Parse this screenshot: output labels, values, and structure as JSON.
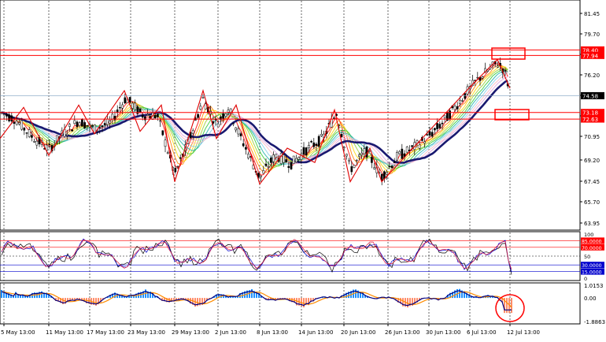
{
  "window": {
    "background": "#ffffff",
    "grid_color": "#000000",
    "axis_color": "#000000"
  },
  "main_panel": {
    "price_ticks": [
      "81.45",
      "79.70",
      "77.95",
      "76.20",
      "74.45",
      "72.70",
      "70.95",
      "69.20",
      "67.45",
      "65.70",
      "63.95"
    ],
    "price_range": [
      63.95,
      81.45
    ],
    "current_price": {
      "label": "74.58",
      "value": 74.58,
      "color": "#000000"
    },
    "resistance_zone": {
      "upper_label": "78.40",
      "lower_label": "77.94",
      "upper": 78.4,
      "lower": 77.94,
      "color": "#ff0000"
    },
    "support_zone": {
      "upper_label": "73.18",
      "lower_label": "72.63",
      "upper": 73.18,
      "lower": 72.63,
      "color": "#ff0000"
    },
    "colors": {
      "bull_candle": "#ffffff",
      "bear_candle": "#000000",
      "zigzag": "#e00000",
      "ma_main": "#191970",
      "rainbow": [
        "#ff0000",
        "#ff7f00",
        "#ffd700",
        "#9acd32",
        "#32cd32",
        "#20b2aa",
        "#87ceeb",
        "#ffb6c1",
        "#dda0dd"
      ]
    }
  },
  "oscillator_panel": {
    "ticks": [
      "100",
      "85.0000",
      "70.0000",
      "50",
      "30.0000",
      "15.0000",
      "0"
    ],
    "levels": [
      85,
      70,
      50,
      30,
      15
    ],
    "range": [
      0,
      100
    ],
    "level_colors": {
      "85.0000": "#ff0000",
      "70.0000": "#ff0000",
      "30.0000": "#0000cd",
      "15.0000": "#0000cd"
    }
  },
  "macd_panel": {
    "ticks": [
      "1.0153",
      "0.00",
      "-1.8863"
    ],
    "range": [
      -1.8863,
      1.0153
    ],
    "colors": {
      "positive": "#1e90ff",
      "negative": "#ff8c69",
      "signal": "#ff8c00",
      "main": "#000080"
    }
  },
  "time_axis": {
    "labels": [
      "5 May 13:00",
      "11 May 13:00",
      "17 May 13:00",
      "23 May 13:00",
      "29 May 13:00",
      "2 Jun 13:00",
      "8 Jun 13:00",
      "14 Jun 13:00",
      "20 Jun 13:00",
      "26 Jun 13:00",
      "30 Jun 13:00",
      "6 Jul 13:00",
      "12 Jul 13:00"
    ]
  },
  "annotations": {
    "highlight_color": "#ff0000",
    "items": [
      "resistance-box",
      "support-box",
      "macd-circle"
    ]
  }
}
